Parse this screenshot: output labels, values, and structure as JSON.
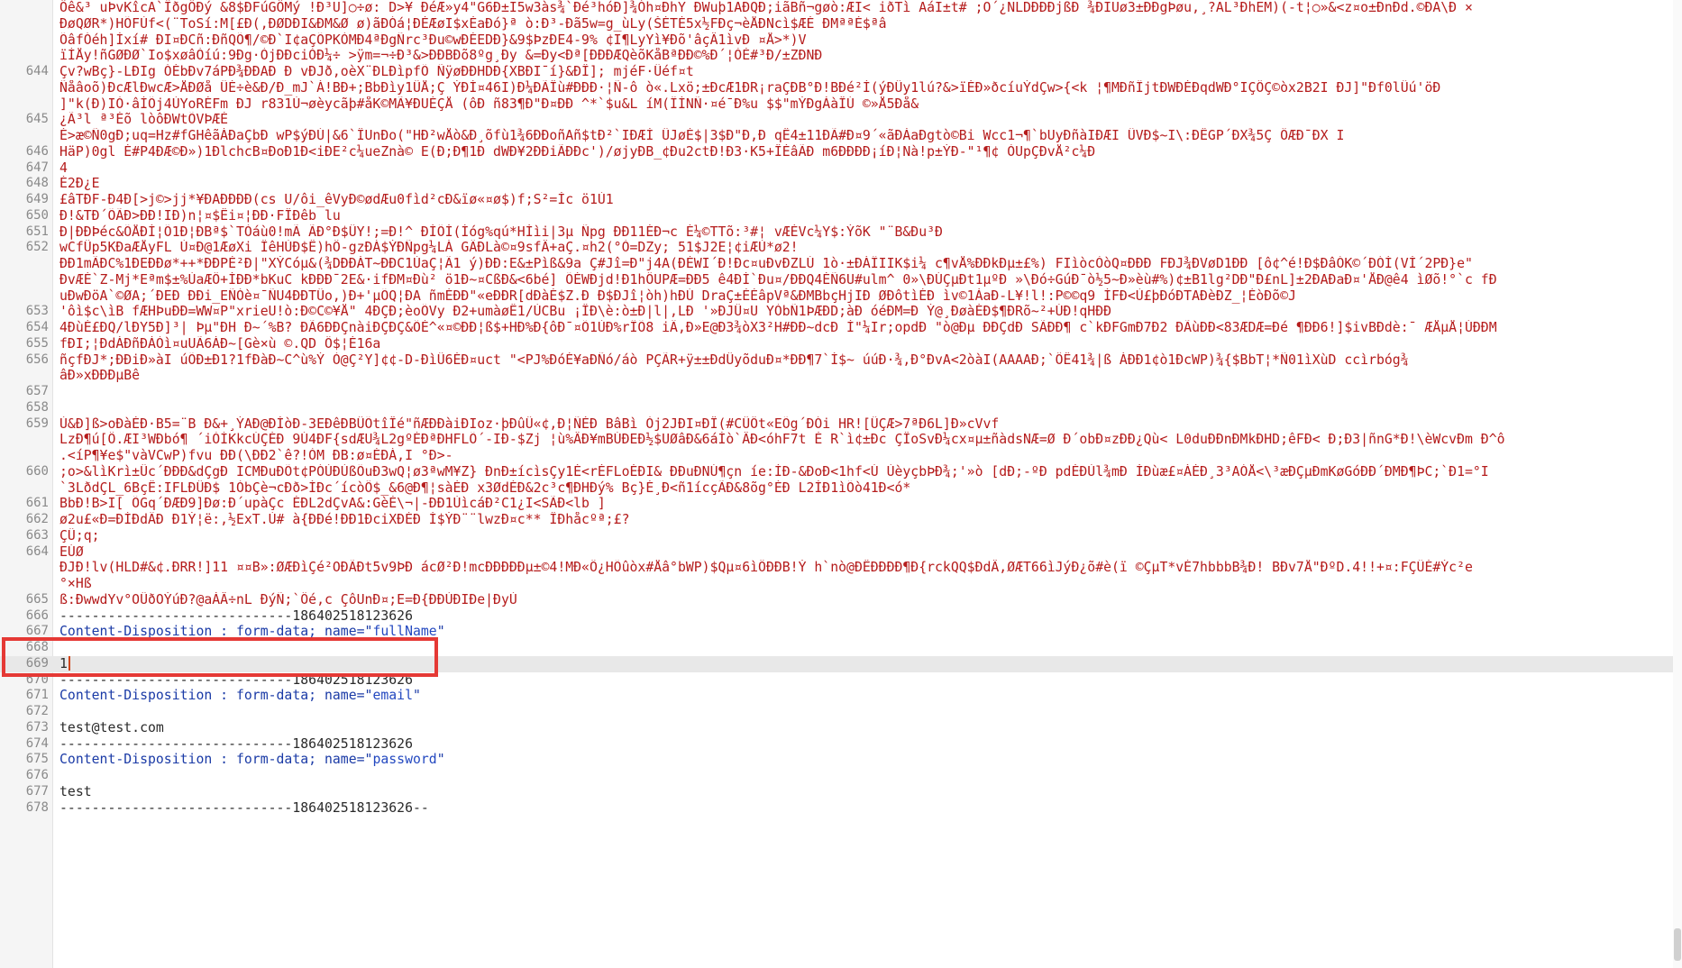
{
  "editor": {
    "lines": [
      {
        "n": "",
        "kind": "bin",
        "t": "Ôê&³ uÞvKîcA`ÏðgÖÐý &8$ÐFúGÔMý !Ð³U]○÷ø: D>¥ ÐéÆ»y4\"G6Ð±I5w3às¾`Ðé³hóÐ]¾Óh¤ÐhY ÐWuþ1AÐQÐ;iãBñ¬gøò:ÆI< iðTì AáI±t# ;O´¿NLDÐÐÐjßÐ ¾ÐIUø3±ÐÐgÞøu,¸?AL³ÐhEM)(-t¦○»&<z¤o±ÐnÐd.©ÐA\\Ð ×"
      },
      {
        "n": "",
        "kind": "bin",
        "t": "ÐøQØR*)HÕFÙf<(¨ToSí:M[£Ð(,ÐØDÐI&ÐM&Ø ø)ãÐÓá¦ÐÈÆøI$xÈaÐó}ª ò:Ð³-Ðã5w=g_ùLy(ŠÉTÉ5x½FÐç¬èÅÐNcì$ÆÉ ÐMªªÈ$ªâ"
      },
      {
        "n": "",
        "kind": "bin",
        "t": "ÕâfÓéh]Ìxí# ÐI¤ÐCñ:ÐñQÕ¶/©Ð`I¢aÇÕPKÒMÐ4ªÐgÑrc³Ðu©wÐÉEDÐ}&9$ÞzÐE4-9% ¢I¶LyYì¥Ðõ'âçÂ1ìvÐ ¤Å>*)V"
      },
      {
        "n": "",
        "kind": "bin",
        "t": "ïÌÅy!ñGØÐØ`Io$xøâÒíú:9Ðg·ÒjÐÐciÒÐ¼÷ >ÿm=¬÷Ð³&>ÐÐBÐõ8ºg¸Ðy &=Ðy<Ðª[ÐÐÐÆQèõKåBªÐÐ©%Ð´¦ÒÈ#³Ð/±ZÐNÐ"
      },
      {
        "n": "644",
        "kind": "bin",
        "t": "Çv?wBç}-LÐIg ÓÉbÐv7áPÐ¾ÐÐAÐ Ð vÐJð,oèX¨ÐLÐìpfÕ ÑÿøÐÐHDÐ{XBÐI¯í}&ÐÎ]; mjéF·Üéf¤t"
      },
      {
        "n": "",
        "kind": "bin",
        "t": "Ñåâoõ)ÐcÆlÐwcÆ>ÅÐØå ÜÉ÷è&Ð/Ð_mJ`Á!BÐ+;BbÐìy1ÛÅ;Ç ÝÐÍ¤46I)Ð¼ÐÃÎù#ÐÐÐ·¦Ñ-ô ò«.Lxö;±ÐcÆ1ÐR¡raÇÐB°Ð!BÐé²Ì(ýÐÛy1lú?&>ïÉÐ»ðcíuÝdÇw>{<k ¦¶MÐñÏjtÐWÐÉÐqdWÐ°IÇÔÇ©òx2B2I ÐJ]\"Ðf0lÛú'öÐ"
      },
      {
        "n": "",
        "kind": "bin",
        "t": "]\"k(Ð)IÒ·âÍÕj4ÙYoRÉFm ÐJ r831Ù¬øèycãþ#åK©MÃ¥ÐUÉÇÅ (ôÐ ñ83¶Ð\"Ð¤ÐÐ ^*`$u&L íM(ÏÍNÑ·¤é¯Ð%u $$\"mÝÐgÀàÎÚ ©»Å5Ðå&"
      },
      {
        "n": "645",
        "kind": "bin",
        "t": "¿Ã³l ª³Éõ lòôÐWtÕVÞÆÈ"
      },
      {
        "n": "",
        "kind": "bin",
        "t": "É>æ©Ñ0gÐ;uq=Hz#fGHêãÁÐaÇbÐ wP$ýÐÚ|&6`ÎUnÐo(\"HÐ²wÅò&Ð¸õfù1¾6ÐÐoñAñ$tÐ²`IÐÆÌ ÛJøÈ$|3$Ð\"Ð,Ð qÊ4±11ÐÃ#Ð¤9´«ãÐÀaÐgtò©Bi Wcc1¬¶`bUyÐñàIÐÆI ÜVÐ$~I\\:ÐÊGP´ÐX¾5Ç ÔÆÐ¯ÐX I"
      },
      {
        "n": "646",
        "kind": "bin",
        "t": "HäP)0gl É#P4ÐÆ©Ð»)1ÐlchcB¤ÐoÐ1Ð<iÐE²c¼ueZnà© E(Ð;Ð¶1Ð dWÐ¥2ÐÐiÃÐÐc')/øjyÐB_¢Ðu2ctÐ!Ð3·K5+ÎÈâÃÐ m6ÐÐÐÐ¡íÐ¦Nà!p±ÝÐ-\"¹¶¢ ÒUpÇÐvÅ²c¼Ð"
      },
      {
        "n": "647",
        "kind": "bin",
        "t": "4"
      },
      {
        "n": "648",
        "kind": "bin",
        "t": "É2Ð¿E"
      },
      {
        "n": "649",
        "kind": "bin",
        "t": "£âTÐF-Ð4Ð[>j©>jj*¥ÐAÐÐÐÐ(cs U/ôi_êVyÐ©ødÆu0fìd²cÐ&ïø«¤ø$)f;S²=Ìc ö1Ù1"
      },
      {
        "n": "650",
        "kind": "bin",
        "t": "Ð!&TÐ´ÕÃÐ>ÐÐ!IÐ)n¦¤$Êi¤¦ÐÐ·FÎÐêb lu"
      },
      {
        "n": "651",
        "kind": "bin",
        "t": "Ð|ÐÐÞéc&ÕÅÐÍ¦Õ1Ð¦ÐBª$`TÒáù0!mÃ ÃÐ°Ð$ÛY!;=Ð!^ ÐÍÕÍ(Íóg%qú*HÍìi|3µ Ñpg ÐÐ11ÉÐ¬c É¼©TTõ:³#¦ vÆÈVc¼Y$:ÝõK \"¨B&Ðu³Ð"
      },
      {
        "n": "652",
        "kind": "bin",
        "t": "wCfÛp5KÐaÆÅyFL Ù¤Ð@1ÆøXi ÎêHÙÐ$Ê)hÔ-gzÐÁ$ÝÐÑpg¼LÁ GÄÐLà©¤9sfÂ+aÇ.¤h2(°Ò=DZy; 51$J2E¦¢iÆÙ*ø2!"
      },
      {
        "n": "",
        "kind": "bin",
        "t": "ÐÐ1mÃÐC%1ÐEÐÐø*++*ÐÐPÈ²Ð|\"XÝCóµ&(¾DÐÐÁT~ÐÐC1ÙaÇ¦Ã1 ý)ÐÐ:E&±Pìß&9a Ç#Jî=Ð\"j4A(ÐÈWI´Ð!Ðc¤uÐvÐZLÚ 1ò·±ÐÁÏIIK$i¼ c¶vÅ%ÐÐkÐµ±£%) FIìòcÒòQ¤ÐÐÐ FÐJ¾ÐVøD1ÐÐ [ô¢^é!Ð$ÐâÓK©´ÐÓÍ(VÍ´2PÐ}e\""
      },
      {
        "n": "",
        "kind": "bin",
        "t": "ÐvÆÉ`Z-Mj*Eªm$±%ÙaÆÔ+ÍÐÐ*bKuC kÐÐÐ¯2E&·ifÐM¤Ðù² ö1Ð~¤CßÐ&<6bé] ÕÉWÐjd!Ð1hÔUPÆ=ÐÐ5 ê4ÐÍ`Ðu¤/ÐÐQ4ÉÑ6U#ulm^ 0»\\ÐÚÇµÐt1µºÐ »\\Ðó÷GúÐ¯ò½5~Ð»èù#%)¢±B1lg²DÐ\"Ð£nL]±2ÐAÐaÐ¤'ÅÐ@ê4 ìØõ!°`c fÐ"
      },
      {
        "n": "",
        "kind": "bin",
        "t": "uÐwÐöA`©ØA;´ÐEÐ ÐÐi_EÑÒè¤¯ÑU4ÐÐTÜo,)Ð+'µÕQ¦ÐA ñmÉÐÐ\"«eÐÐR[dÐàÉ$Z.Ð Ð$ÐJî¦òh)hÐÚ DraÇ±ÈÈâpVª&ÐMBbçHjIÐ ØÐôtìÉÐ ìv©1ÀaÐ-L¥!l!:P©©q9 ÍFÐ<Ù£þÐóÐTAÐèÐZ_¦ÈòÐõ©J"
      },
      {
        "n": "653",
        "kind": "bin",
        "t": "'ôì$c\\ìB fÆHÞuÐÐ=WW¤P\"xrieU!ò:Ð©C©¥Å\" 4ÐÇÐ;èoÕVy Ð2+umàøÊ1/ÙCBu ¡ÎÐ\\è:ò±Ð|l|,LÐ '»ÐJÛ¤U YÒbÑ1ÞÆÐD;àÐ óéÐM=Ð Ý@¸ÐøàÉÐ$¶ÐRõ~²+ÚÐ!qHÐÐ"
      },
      {
        "n": "654",
        "kind": "bin",
        "t": "4ÐùÉ£ÐQ/lÐY5Ð]³| Þµ\"ÐH Ð~´%B? ÐÃ6ÐÐÇnàiÐÇÐÇ&ÕÈ^«¤©ÐÐ¦ß$+HÐ%Ð{ôÐ¯¤Õ1ÙÐ%rÏÕ8 iÄ,Ð»E@Ð3¾òX3²H#ÐÐ~dcÐ Ì\"¼Ir;opdÐ \"ò@Ðµ ÐÐÇdÐ SÃÐÐ¶ c`kÐFGmÐ7Ð2 ÐÃùÐÐ<83ÆDÆ=Ðé ¶ÐÐ6!]$ivBÐdè:¯ ÆÅµÅ¦ÚÐÐM"
      },
      {
        "n": "655",
        "kind": "bin",
        "t": "fÐI;¦ÐdÁÐñÐÀÒì¤uUÃ6ÁÐ~[Gè×ù ©.QD Ô$¦É16a"
      },
      {
        "n": "656",
        "kind": "bin",
        "t": "ñçfÐJ*;ÐÐiÐ»àI úÕÐ±Ð1?1fÐàÐ~C^ù%Ý Ò@Ç²Y]¢¢-D-ÐìÛ6ÉÐ¤uct \"<PJ%ÐóÉ¥aÐÑó/áò PÇÃR+ÿ±±ÐdÛyõduÐ¤*ÐÐ¶7`Í$~ úúÐ·¾,Ð°ÐvA<2òàI(AAAAÐ;`ÔÊ41¾|ß ÁÐÐ1¢ò1ÐcWP)¾{$BbT¦*Ñ01ìXùD ccìrbóg¾"
      },
      {
        "n": "",
        "kind": "bin",
        "t": "âÐ»xÐÐÐµBê"
      },
      {
        "n": "657",
        "kind": "bin",
        "t": ""
      },
      {
        "n": "658",
        "kind": "bin",
        "t": ""
      },
      {
        "n": "659",
        "kind": "bin",
        "t": "Ù&Ð]ß>oÐàÈÐ·B5=¨B Ð&+¸ÝAÐ@ÐÍòÐ-3EÐêÐBÛÕtîÎé\"ñÆÐÐàiÐIoz·þÐûÛ«¢,Ð¦ÑÈÐ BâBì Òj2JÐI¤ÐÎ(#CÛÔt«EÕg´ÐÓi HR![ÛÇÆ>7ªÐ6L]Ð»cVvf"
      },
      {
        "n": "",
        "kind": "bin",
        "t": "LzÐ¶ú[Ô.ÆI³WÐbó¶ ´iÒÍKkcÚÇÉÐ 9Ú4ÐF{sdÆU¾L2gºÉÐªÐHFLÕ´-IÐ-$Zj ¦ù%ÂÐ¥mBÚÐEÐ½$UØâÐ&6áÍò`ÂÐ<óhF7t È R`ì¢±Ðc ÇÎoSvÐ¼cx¤µ±ñàdsNÆ=Ø Ð´obÐ¤zÐÐ¿Qù< L0duÐÐnÐMkÐHD;êFÐ< Ð;Ð3|ñnG*Ð!\\èWcvÐm Ð^ô"
      },
      {
        "n": "",
        "kind": "bin",
        "t": ".<íP¶¥e$\"vàVCwP)fvu ÐÐ(\\ÐÐ2`ê?!ÒM ÐB:ø¤ÉÐÁ,I °Ð>-"
      },
      {
        "n": "660",
        "kind": "bin",
        "t": ";o>&lìKrì±Ûc´ÐÐÐ&dÇgÐ ICMÐuÐÕt¢PÓÙÐÙßÕuÐ3wQ¦ø3ªwM¥Z} ÐnÐ±ícìsÇy1É<rÈFLoÉÐI& ÐÐuÐNÚ¶çn íe:ÌÐ-&ÐoÐ<1hf<Ú ÙèyçbÞÐ¾;'»ò [dÐ;-ºÐ pdÉÐÙl¾mÐ ÍÐùæ£¤ÁÉÐ¸3³AÓÅ<\\³æÐÇµÐmKøGóÐÐ´ÐMÐ¶ÞC;`Ð1=°I"
      },
      {
        "n": "",
        "kind": "bin",
        "t": "`3LðdÇL_6BçÊ:IFLÐÛÐ$ 1ÒbÇè¬cÐð>ÍÐc´ícòÖ$_&6@Ð¶¦sàÈÐ x3ØdÉÐ&2c³c¶ÐHÐý% Bç}É¸Ð<ñ1ícçÃÐ&8õg°ÉÐ L2ÌÐ1ìÕò41Ð<ó*"
      },
      {
        "n": "661",
        "kind": "bin",
        "t": "BbÐ!B>I[ ÕGq´ÐÆÐ9]Ðø:Ð´upàÇc ÉÐL2dÇvA&:GèÈ\\¬|-ÐÐ1ÙìcáÐ²C1¿I<SÃÐ<lb ]"
      },
      {
        "n": "662",
        "kind": "bin",
        "t": "ø2u£«Ð=ÐÍÐdÄÐ Ð1Ý¦ë:,½ExT.Ù# à{ÐÐé!ÐÐ1ÐciXÐÉÐ Í$ÝÐ¨¨lwzÐ¤c** ÎÐhåcºª;£?"
      },
      {
        "n": "663",
        "kind": "bin",
        "t": "ÇÛ;q;"
      },
      {
        "n": "664",
        "kind": "bin",
        "t": "EÚØ"
      },
      {
        "n": "",
        "kind": "bin",
        "t": "ÐJÐ!lv(HLD#&¢.ÐRR!]11 ¤¤B»:ØÆÐìÇé²OÐÃÐt5v9ÞÐ ácØ²Ð!mcÐÐÐÐÐµ±©4!MÐ«Ô¿HÕûòx#Åâ°bWP)$Qµ¤6ìÔÐÐB!Ý h`nò@ÐÊÐÐÐÐ¶Ð{rckQQ$ÐdÂ,ØÆT66ìJýÐ¿õ#è(ï ©ÇµT*vÉ7hbbbB¾Ð! BÐv7Å\"ÐºD.4!!+¤:FÇÜÉ#Ýc²e"
      },
      {
        "n": "",
        "kind": "bin",
        "t": "°×Hß"
      },
      {
        "n": "665",
        "kind": "bin",
        "t": "ß:ÐwwdYv°OÛðOÝúÐ?@aÀÂ÷nL ÐýÑ;`Ôé,c ÇôUnÐ¤;E=Ð{ÐÐÙÐIÐe|ÐyÙ"
      },
      {
        "n": "666",
        "kind": "plain",
        "t": "-----------------------------186402518123626"
      },
      {
        "n": "667",
        "kind": "field",
        "t": "Content-Disposition : form-data; name=\"",
        "val": "fullName",
        "end": "\""
      },
      {
        "n": "668",
        "kind": "plain",
        "t": ""
      },
      {
        "n": "669",
        "kind": "current",
        "t": "1"
      },
      {
        "n": "670",
        "kind": "plain",
        "t": "-----------------------------186402518123626"
      },
      {
        "n": "671",
        "kind": "field",
        "t": "Content-Disposition : form-data; name=\"",
        "val": "email",
        "end": "\""
      },
      {
        "n": "672",
        "kind": "plain",
        "t": ""
      },
      {
        "n": "673",
        "kind": "plain",
        "t": "test@test.com"
      },
      {
        "n": "674",
        "kind": "plain",
        "t": "-----------------------------186402518123626"
      },
      {
        "n": "675",
        "kind": "field",
        "t": "Content-Disposition : form-data; name=\"",
        "val": "password",
        "end": "\""
      },
      {
        "n": "676",
        "kind": "plain",
        "t": ""
      },
      {
        "n": "677",
        "kind": "plain",
        "t": "test"
      },
      {
        "n": "678",
        "kind": "plain",
        "t": "-----------------------------186402518123626--"
      }
    ]
  },
  "colors": {
    "binary_text": "#b51c1c",
    "field_value": "#2348c0",
    "highlight_box": "#e53935",
    "current_line_bg": "#e8e8e8"
  }
}
